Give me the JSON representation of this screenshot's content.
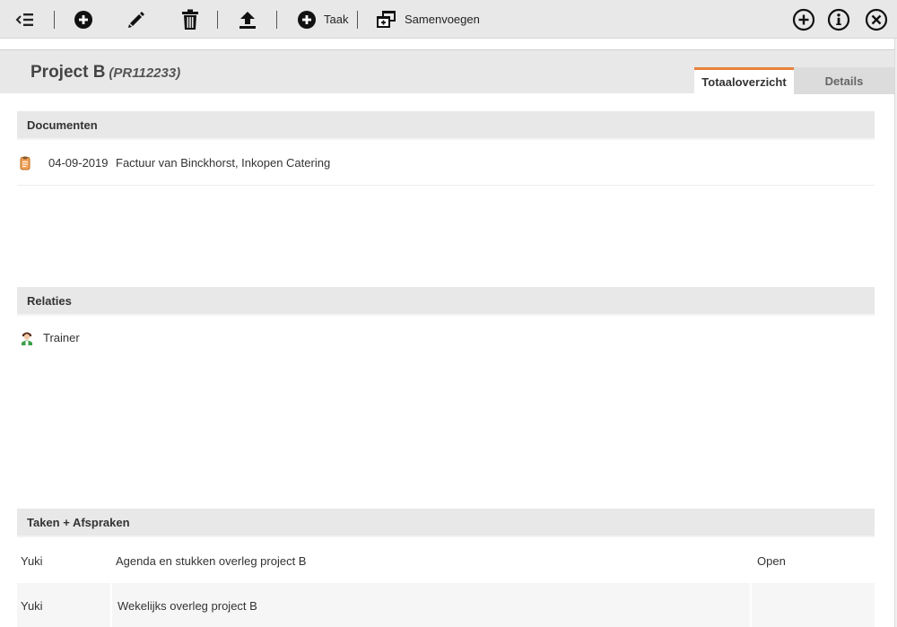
{
  "toolbar": {
    "left_icons": [
      "collapse-menu-icon",
      "add-circle-icon",
      "edit-pencil-icon",
      "trash-icon",
      "upload-icon"
    ],
    "task_label": "Taak",
    "merge_label": "Samenvoegen",
    "right_icons": [
      "add-outline-icon",
      "info-icon",
      "close-circle-icon"
    ]
  },
  "header": {
    "title": "Project B",
    "code": "(PR112233)"
  },
  "tabs": [
    {
      "label": "Totaaloverzicht",
      "active": true
    },
    {
      "label": "Details",
      "active": false
    }
  ],
  "documents": {
    "heading": "Documenten",
    "items": [
      {
        "date": "04-09-2019",
        "description": "Factuur van Binckhorst, Inkopen Catering",
        "icon": "document-icon"
      }
    ]
  },
  "relations": {
    "heading": "Relaties",
    "items": [
      {
        "name": "Trainer",
        "icon": "person-icon"
      }
    ]
  },
  "tasks": {
    "heading": "Taken + Afspraken",
    "items": [
      {
        "who": "Yuki",
        "what": "Agenda en stukken overleg project B",
        "status": "Open"
      },
      {
        "who": "Yuki",
        "what": "Wekelijks overleg project B",
        "status": ""
      }
    ]
  },
  "colors": {
    "accent": "#e8813a",
    "toolbar_bg": "#e8e8e8",
    "section_bg": "#e8e8e8"
  }
}
